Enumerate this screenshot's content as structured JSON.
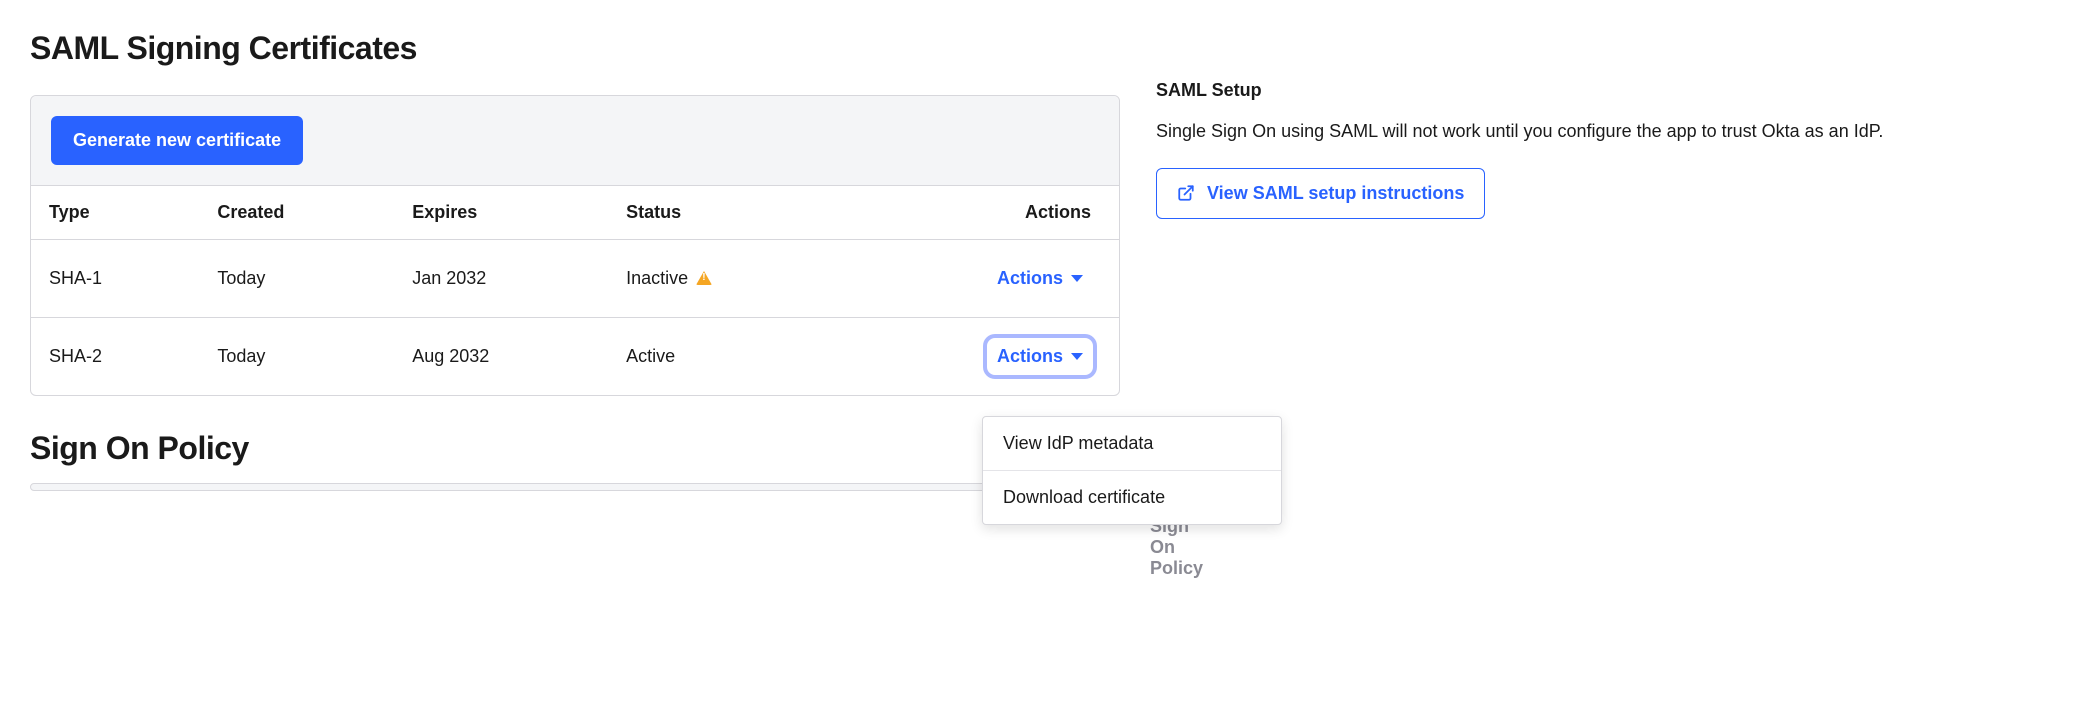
{
  "sections": {
    "certificates_title": "SAML Signing Certificates",
    "policy_title": "Sign On Policy"
  },
  "toolbar": {
    "generate_label": "Generate new certificate"
  },
  "table": {
    "headers": {
      "type": "Type",
      "created": "Created",
      "expires": "Expires",
      "status": "Status",
      "actions": "Actions"
    },
    "rows": [
      {
        "type": "SHA-1",
        "created": "Today",
        "expires": "Jan 2032",
        "status": "Inactive",
        "status_warning": true,
        "actions_label": "Actions"
      },
      {
        "type": "SHA-2",
        "created": "Today",
        "expires": "Aug 2032",
        "status": "Active",
        "status_warning": false,
        "actions_label": "Actions"
      }
    ]
  },
  "dropdown": {
    "items": [
      "View IdP metadata",
      "Download certificate"
    ]
  },
  "sidebar": {
    "title": "SAML Setup",
    "text": "Single Sign On using SAML will not work until you configure the app to trust Okta as an IdP.",
    "button_label": "View SAML setup instructions"
  },
  "ghost": {
    "policy_title": "Sign On Policy"
  }
}
